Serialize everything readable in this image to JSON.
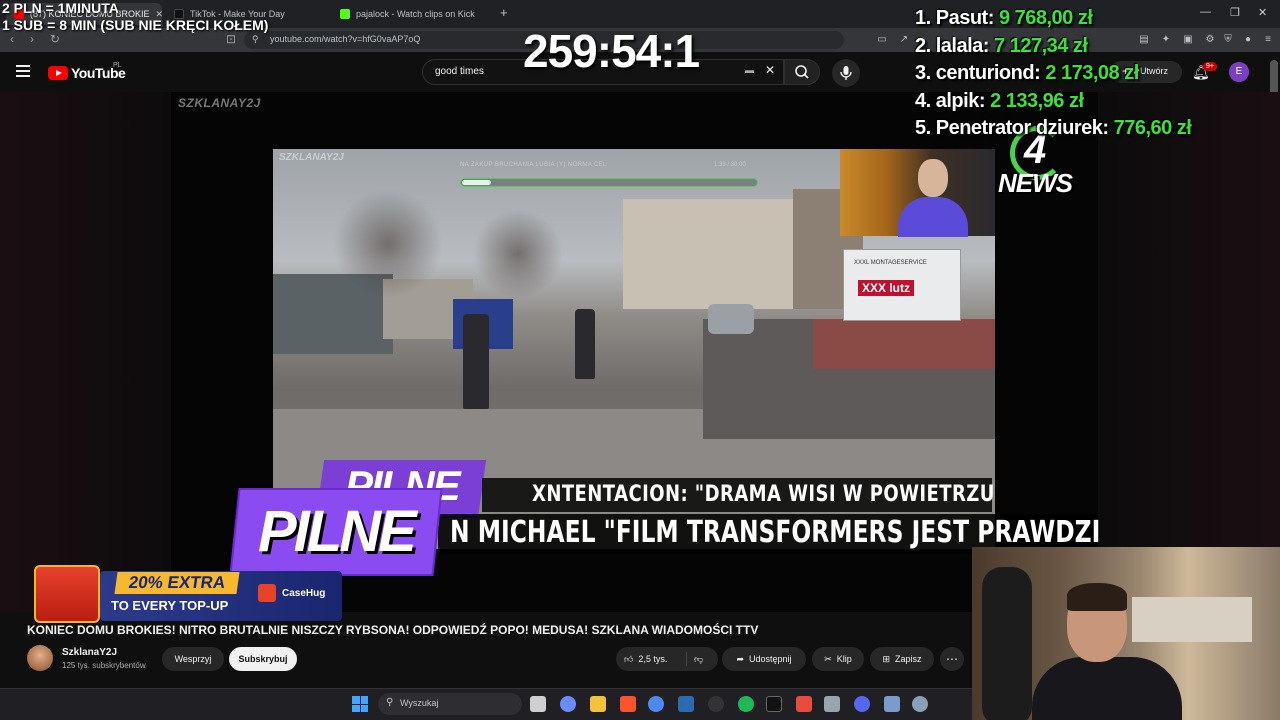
{
  "browser": {
    "tabs": [
      {
        "label": "(87) KONIEC DOMU BROKIE",
        "favicon_color": "#ff0000"
      },
      {
        "label": "TikTok - Make Your Day",
        "favicon_color": "#111111"
      },
      {
        "label": "pajalock - Watch clips on Kick",
        "favicon_color": "#53fc18"
      }
    ],
    "new_tab": "+",
    "url": "youtube.com/watch?v=hfG0vaAP7oQ"
  },
  "youtube": {
    "logo_text": "YouTube",
    "country": "PL",
    "search_value": "good times",
    "create_label": "Utwórz",
    "notifications": "9+",
    "avatar_letter": "E"
  },
  "video": {
    "watermark": "SZKLANAY2J",
    "progress_label": "NA ZAKUP BRUCHANIA LUBIA (Y) NORMA CEL",
    "progress_time": "1:33 / 30:00",
    "progress_fraction": 0.1,
    "truck_text": "XXXL MONTAGESERVICE",
    "truck_logo": "XXX lutz",
    "news_digit": "4",
    "news_text": "NEWS",
    "breaking_label": "PILNE",
    "ticker_top": "XNTENTACION: \"DRAMA WISI W POWIETRZU",
    "ticker_bottom": "N MICHAEL \"FILM TRANSFORMERS JEST PRAWDZI",
    "ad": {
      "extra": "20% EXTRA",
      "topup": "TO EVERY TOP-UP",
      "brand": "CaseHug"
    },
    "title": "KONIEC DOMU BROKIES! NITRO BRUTALNIE NISZCZY RYBSONA! ODPOWIEDŹ POPO! MEDUSA! SZKLANA WIADOMOŚCI TTV",
    "channel": "SzklanaY2J",
    "subscribers": "125 tys. subskrybentów",
    "support_label": "Wesprzyj",
    "subscribe_label": "Subskrybuj",
    "likes": "2,5 tys.",
    "share_label": "Udostępnij",
    "clip_label": "Klip",
    "save_label": "Zapisz"
  },
  "taskbar": {
    "search_placeholder": "Wyszukaj"
  },
  "stream_overlay": {
    "rate": "2 PLN = 1MINUTA",
    "sub_rule": "1 SUB = 8 MIN (SUB NIE KRĘCI KOŁEM)",
    "timer": "259:54:1",
    "leaderboard": [
      {
        "rank": "1.",
        "name": "Pasut:",
        "amount": "9 768,00 zł"
      },
      {
        "rank": "2.",
        "name": "lalala:",
        "amount": "7 127,34 zł"
      },
      {
        "rank": "3.",
        "name": "centuriond:",
        "amount": "2 173,08 zł"
      },
      {
        "rank": "4.",
        "name": "alpik:",
        "amount": "2 133,96 zł"
      },
      {
        "rank": "5.",
        "name": "Penetrator dziurek:",
        "amount": "776,60 zł"
      }
    ]
  },
  "colors": {
    "youtube_red": "#ff0000",
    "amount_green": "#3ee03a",
    "breaking_purple": "#8a4bf0",
    "casehug_gold": "#f5b82e"
  }
}
